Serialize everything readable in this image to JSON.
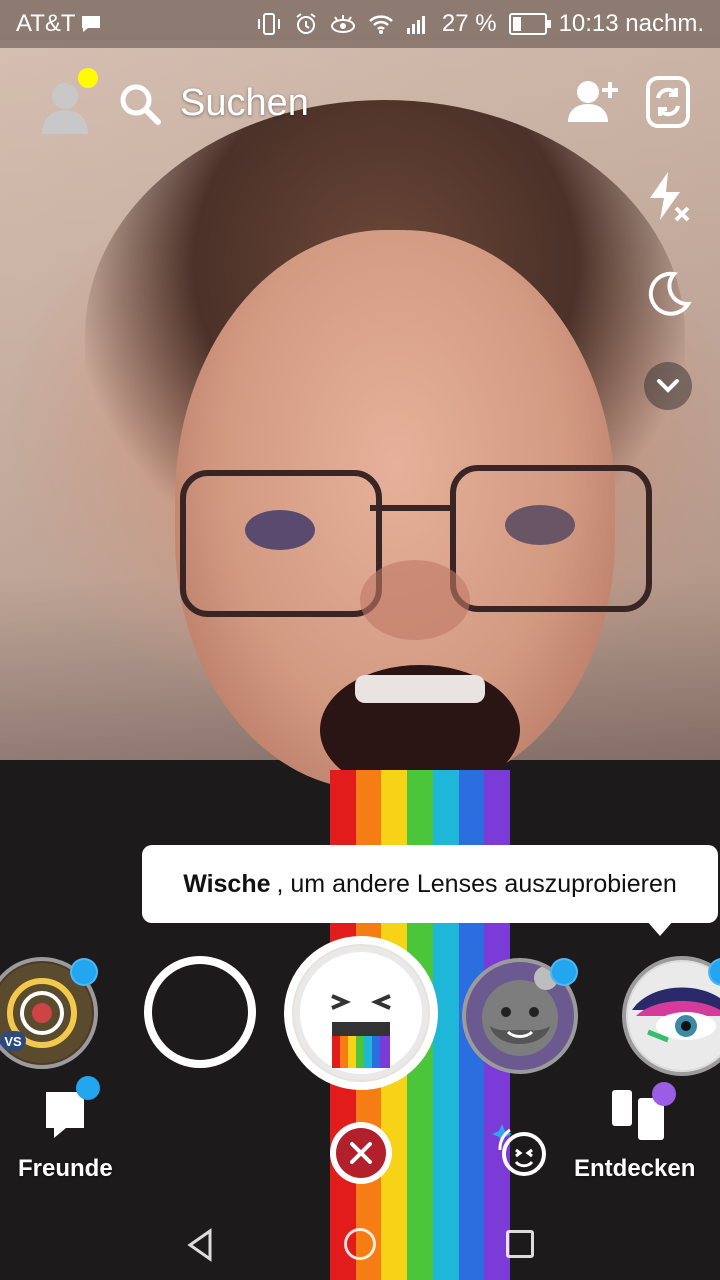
{
  "status_bar": {
    "carrier": "AT&T",
    "battery_percent": "27 %",
    "battery_level": 0.27,
    "time": "10:13 nachm."
  },
  "top_bar": {
    "search_label": "Suchen"
  },
  "tooltip": {
    "bold": "Wische",
    "rest": ", um andere Lenses auszuprobieren"
  },
  "lenses": [
    {
      "name": "lens-vs",
      "badge": "VS",
      "new": true
    },
    {
      "name": "lens-empty",
      "new": false
    },
    {
      "name": "lens-rainbow",
      "selected": true
    },
    {
      "name": "lens-beard",
      "new": true
    },
    {
      "name": "lens-eye-makeup",
      "new": true
    }
  ],
  "bottom_nav": {
    "friends_label": "Freunde",
    "discover_label": "Entdecken"
  },
  "colors": {
    "snap_yellow": "#fffc00",
    "notification_blue": "#23a6ef",
    "discover_purple": "#9b5de5",
    "close_red": "#b2202c"
  },
  "icons": [
    "avatar-icon",
    "search-icon",
    "add-friend-icon",
    "flip-camera-icon",
    "flash-off-icon",
    "night-mode-icon",
    "chevron-down-icon",
    "chat-icon",
    "discover-icon",
    "close-icon",
    "lens-explorer-icon"
  ]
}
